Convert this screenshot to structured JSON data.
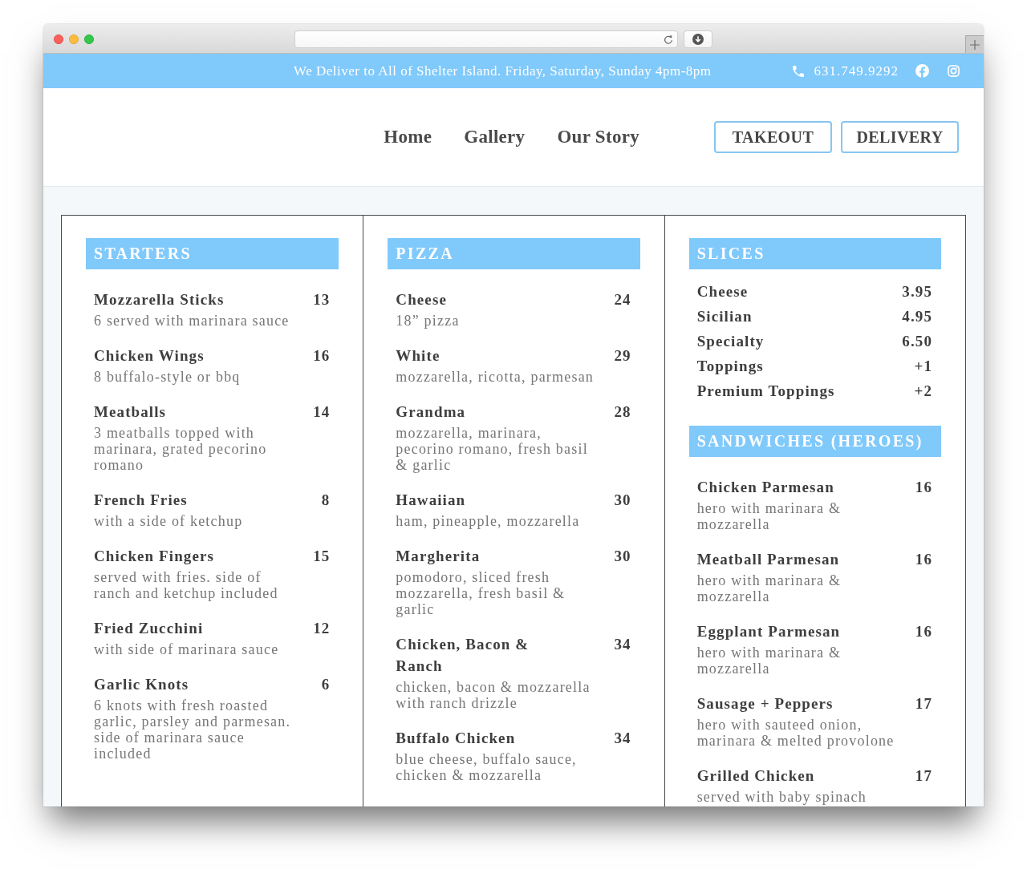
{
  "announcement_bar": {
    "message": "We Deliver to All of Shelter Island. Friday, Saturday, Sunday 4pm-8pm",
    "phone": "631.749.9292"
  },
  "header": {
    "nav": [
      {
        "label": "Home"
      },
      {
        "label": "Gallery"
      },
      {
        "label": "Our Story"
      }
    ],
    "buttons": [
      {
        "label": "TAKEOUT"
      },
      {
        "label": "DELIVERY"
      }
    ]
  },
  "menu": {
    "columns": [
      {
        "sections": [
          {
            "title": "STARTERS",
            "kind": "detailed",
            "items": [
              {
                "name": "Mozzarella Sticks",
                "price": "13",
                "description": "6 served with marinara sauce"
              },
              {
                "name": "Chicken Wings",
                "price": "16",
                "description": "8 buffalo-style or bbq"
              },
              {
                "name": "Meatballs",
                "price": "14",
                "description": "3 meatballs topped with marinara, grated pecorino romano"
              },
              {
                "name": "French Fries",
                "price": "8",
                "description": "with a side of ketchup"
              },
              {
                "name": "Chicken Fingers",
                "price": "15",
                "description": "served with fries. side of ranch and ketchup included"
              },
              {
                "name": "Fried Zucchini",
                "price": "12",
                "description": "with side of marinara sauce"
              },
              {
                "name": "Garlic Knots",
                "price": "6",
                "description": "6 knots with fresh roasted garlic, parsley and parmesan. side of marinara sauce included"
              }
            ]
          }
        ]
      },
      {
        "sections": [
          {
            "title": "PIZZA",
            "kind": "detailed",
            "items": [
              {
                "name": "Cheese",
                "price": "24",
                "description": "18” pizza"
              },
              {
                "name": "White",
                "price": "29",
                "description": "mozzarella, ricotta, parmesan"
              },
              {
                "name": "Grandma",
                "price": "28",
                "description": "mozzarella, marinara, pecorino romano, fresh basil & garlic"
              },
              {
                "name": "Hawaiian",
                "price": "30",
                "description": "ham, pineapple, mozzarella"
              },
              {
                "name": "Margherita",
                "price": "30",
                "description": "pomodoro, sliced fresh mozzarella, fresh basil & garlic"
              },
              {
                "name": "Chicken, Bacon & Ranch",
                "price": "34",
                "description": "chicken, bacon & mozzarella with ranch drizzle"
              },
              {
                "name": "Buffalo Chicken",
                "price": "34",
                "description": "blue cheese, buffalo sauce, chicken & mozzarella"
              }
            ]
          }
        ]
      },
      {
        "sections": [
          {
            "title": "SLICES",
            "kind": "list",
            "items": [
              {
                "name": "Cheese",
                "price": "3.95"
              },
              {
                "name": "Sicilian",
                "price": "4.95"
              },
              {
                "name": "Specialty",
                "price": "6.50"
              },
              {
                "name": "Toppings",
                "price": "+1"
              },
              {
                "name": "Premium Toppings",
                "price": "+2"
              }
            ]
          },
          {
            "title": "SANDWICHES (HEROES)",
            "kind": "detailed",
            "items": [
              {
                "name": "Chicken Parmesan",
                "price": "16",
                "description": "hero with marinara & mozzarella"
              },
              {
                "name": "Meatball Parmesan",
                "price": "16",
                "description": "hero with marinara & mozzarella"
              },
              {
                "name": "Eggplant Parmesan",
                "price": "16",
                "description": "hero with marinara & mozzarella"
              },
              {
                "name": "Sausage + Peppers",
                "price": "17",
                "description": "hero with sauteed onion, marinara & melted provolone"
              },
              {
                "name": "Grilled Chicken",
                "price": "17",
                "description": "served with baby spinach"
              }
            ]
          }
        ]
      }
    ]
  }
}
